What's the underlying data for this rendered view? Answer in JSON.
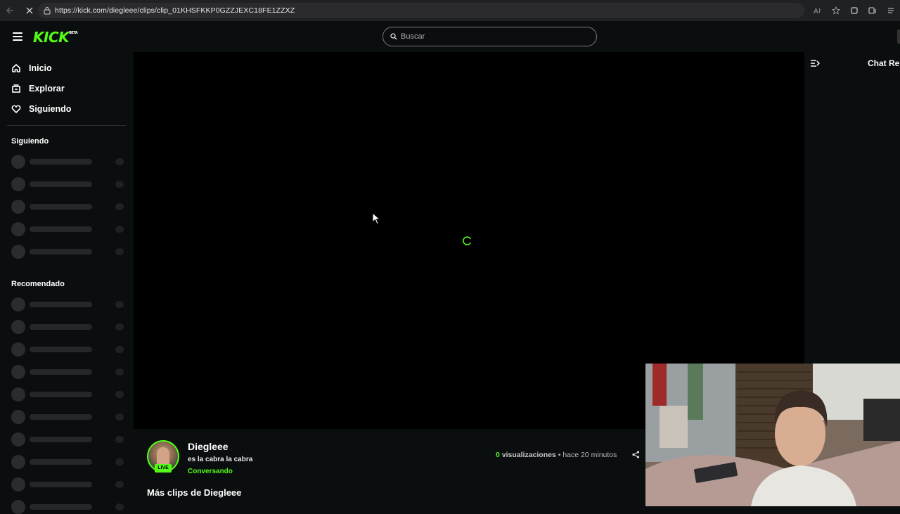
{
  "browser": {
    "url": "https://kick.com/diegleee/clips/clip_01KHSFKKP0GZZJEXC18FE1ZZXZ"
  },
  "header": {
    "logo": "KICK",
    "logo_tag": "BETA",
    "search_placeholder": "Buscar"
  },
  "sidebar": {
    "nav": [
      {
        "label": "Inicio",
        "icon": "home-icon"
      },
      {
        "label": "Explorar",
        "icon": "explore-icon"
      },
      {
        "label": "Siguiendo",
        "icon": "heart-icon"
      }
    ],
    "following_title": "Siguiendo",
    "recommended_title": "Recomendado"
  },
  "chat": {
    "title": "Chat Rep"
  },
  "clip": {
    "streamer": "Diegleee",
    "title": "es la cabra la cabra",
    "category": "Conversando",
    "live_badge": "LIVE",
    "views": "0",
    "views_label": "visualizaciones",
    "separator": "•",
    "time": "hace 20 minutos",
    "more_clips": "Más clips de Diegleee"
  },
  "colors": {
    "brand_green": "#53fc18",
    "background": "#0b0e0f"
  }
}
